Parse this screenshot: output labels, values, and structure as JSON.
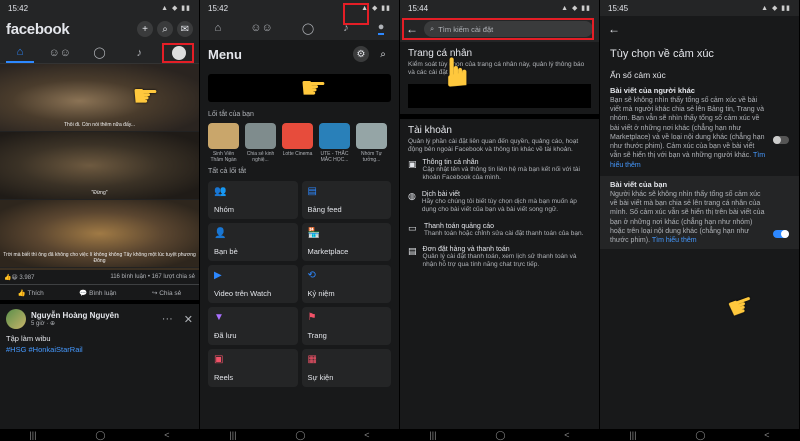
{
  "panel1": {
    "status_time": "15:42",
    "logo": "facebook",
    "header_icons": [
      "plus-icon",
      "search-icon",
      "messenger-icon"
    ],
    "tabs": [
      "home-icon",
      "friends-icon",
      "profile-icon",
      "bell-icon",
      "menu-avatar-icon"
    ],
    "subtitles": [
      "Thôi đi. Còn nói thêm nữa đấy...",
      "\"Đừng\"",
      "Trời mà biết thì ông đã không cho việc lí không không Tây không một lúc tuyệt phương Đông"
    ],
    "reaction_count": "3.987",
    "comment_share": "116 bình luận • 167 lượt chia sẻ",
    "actions": [
      "Thích",
      "Bình luận",
      "Chia sẻ"
    ],
    "post": {
      "author": "Nguyễn Hoàng Nguyên",
      "meta": "5 giờ · ⊕",
      "text": "Tập làm wibu",
      "tags": "#HSG #HonkaiStarRail"
    }
  },
  "panel2": {
    "status_time": "15:42",
    "menu_title": "Menu",
    "shortcut_section": "Lối tắt của bạn",
    "shortcuts": [
      "Sinh Viên Thăm Ngàn",
      "Chia sẻ kinh nghiệ...",
      "Lotte Cinema",
      "UTE - THẮC MẮC HỌC...",
      "Nhóm Tự tưởng..."
    ],
    "all_shortcuts": "Tất cả lối tắt",
    "grid": [
      {
        "icon": "group-icon",
        "label": "Nhóm"
      },
      {
        "icon": "feed-icon",
        "label": "Bảng feed"
      },
      {
        "icon": "friends-icon",
        "label": "Bạn bè"
      },
      {
        "icon": "marketplace-icon",
        "label": "Marketplace"
      },
      {
        "icon": "watch-icon",
        "label": "Video trên Watch"
      },
      {
        "icon": "memories-icon",
        "label": "Kỷ niệm"
      },
      {
        "icon": "saved-icon",
        "label": "Đã lưu"
      },
      {
        "icon": "pages-icon",
        "label": "Trang"
      },
      {
        "icon": "reels-icon",
        "label": "Reels"
      },
      {
        "icon": "events-icon",
        "label": "Sự kiện"
      }
    ]
  },
  "panel3": {
    "status_time": "15:44",
    "search_placeholder": "Tìm kiếm cài đặt",
    "profile_title": "Trang cá nhân",
    "profile_desc": "Kiểm soát tùy chọn của trang cá nhân này, quản lý thông báo và các cài đặt khác.",
    "account_title": "Tài khoản",
    "account_desc": "Quản lý phần cài đặt liên quan đến quyền, quảng cáo, hoạt động bên ngoài Facebook và thông tin khác về tài khoản.",
    "items": [
      {
        "icon": "person-icon",
        "title": "Thông tin cá nhân",
        "desc": "Cập nhật tên và thông tin liên hệ mà bạn kết nối với tài khoản Facebook của mình."
      },
      {
        "icon": "globe-icon",
        "title": "Dịch bài viết",
        "desc": "Hãy cho chúng tôi biết tùy chọn dịch mà bạn muốn áp dụng cho bài viết của bạn và bài viết song ngữ."
      },
      {
        "icon": "payment-icon",
        "title": "Thanh toán quảng cáo",
        "desc": "Thanh toán hoặc chỉnh sửa cài đặt thanh toán của bạn."
      },
      {
        "icon": "orders-icon",
        "title": "Đơn đặt hàng và thanh toán",
        "desc": "Quản lý cài đặt thanh toán, xem lịch sử thanh toán và nhận hỗ trợ qua tính năng chat trực tiếp."
      }
    ]
  },
  "panel4": {
    "status_time": "15:45",
    "title": "Tùy chọn về cảm xúc",
    "subtitle": "Ẩn số cảm xúc",
    "others_heading": "Bài viết của người khác",
    "others_desc": "Bạn sẽ không nhìn thấy tổng số cảm xúc về bài viết mà người khác chia sẻ lên Bảng tin, Trang và nhóm. Bạn vẫn sẽ nhìn thấy tổng số cảm xúc về bài viết ở những nơi khác (chẳng hạn như Marketplace) và về loại nội dung khác (chẳng hạn như thước phim). Cảm xúc của bạn về bài viết vẫn sẽ hiển thị với bạn và những người khác.",
    "yours_heading": "Bài viết của bạn",
    "yours_desc": "Người khác sẽ không nhìn thấy tổng số cảm xúc về bài viết mà bạn chia sẻ lên trang cá nhân của mình. Số cảm xúc vẫn sẽ hiển thị trên bài viết của bạn ở những nơi khác (chẳng hạn như nhóm) hoặc trên loại nội dung khác (chẳng hạn như thước phim).",
    "learn_more": "Tìm hiểu thêm"
  }
}
